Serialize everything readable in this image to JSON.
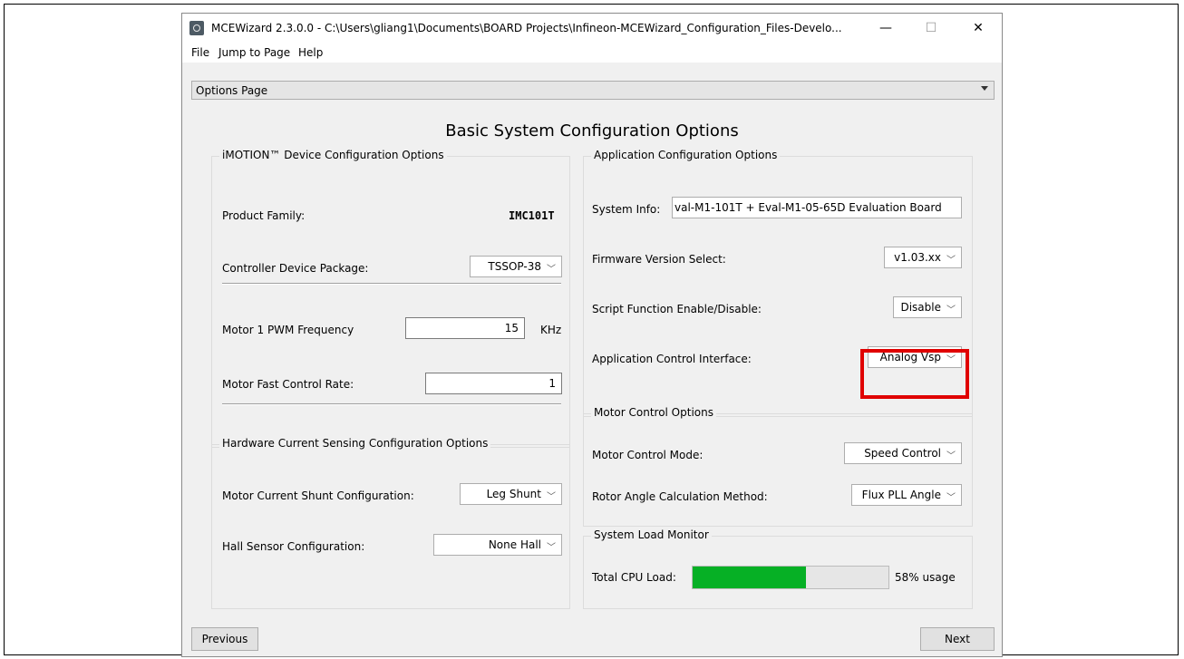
{
  "window": {
    "title": "MCEWizard 2.3.0.0  - C:\\Users\\gliang1\\Documents\\BOARD Projects\\Infineon-MCEWizard_Configuration_Files-Develo...",
    "minimize": "—",
    "maximize": "☐",
    "close": "✕"
  },
  "menu": [
    "File",
    "Jump to Page",
    "Help"
  ],
  "page_selector": {
    "value": "Options Page"
  },
  "heading": "Basic System Configuration Options",
  "device_group": {
    "title": "iMOTION™ Device Configuration Options",
    "product_family_label": "Product Family:",
    "product_family_value": "IMC101T",
    "package_label": "Controller Device Package:",
    "package_value": "TSSOP-38",
    "pwm_label": "Motor 1 PWM Frequency",
    "pwm_value": "15",
    "pwm_unit": "KHz",
    "fast_rate_label": "Motor Fast Control Rate:",
    "fast_rate_value": "1"
  },
  "hw_group": {
    "title": "Hardware Current Sensing Configuration Options",
    "shunt_label": "Motor Current Shunt Configuration:",
    "shunt_value": "Leg Shunt",
    "hall_label": "Hall Sensor Configuration:",
    "hall_value": "None Hall"
  },
  "app_group": {
    "title": "Application Configuration Options",
    "system_info_label": "System Info:",
    "system_info_value": "val-M1-101T + Eval-M1-05-65D Evaluation Board",
    "firmware_label": "Firmware Version Select:",
    "firmware_value": "v1.03.xx",
    "script_label": "Script Function Enable/Disable:",
    "script_value": "Disable",
    "interface_label": "Application Control Interface:",
    "interface_value": "Analog Vsp"
  },
  "motor_group": {
    "title": "Motor Control Options",
    "mode_label": "Motor Control Mode:",
    "mode_value": "Speed Control",
    "rotor_label": "Rotor Angle Calculation Method:",
    "rotor_value": "Flux PLL Angle"
  },
  "load_group": {
    "title": "System Load Monitor",
    "cpu_label": "Total CPU Load:",
    "cpu_percent": 58,
    "cpu_text": "58% usage"
  },
  "buttons": {
    "previous": "Previous",
    "next": "Next"
  },
  "colors": {
    "progress": "#06b025",
    "highlight": "#e00000"
  },
  "icons": {
    "app": "mcewizard-app-icon",
    "dropdown": "chevron-down-icon"
  }
}
